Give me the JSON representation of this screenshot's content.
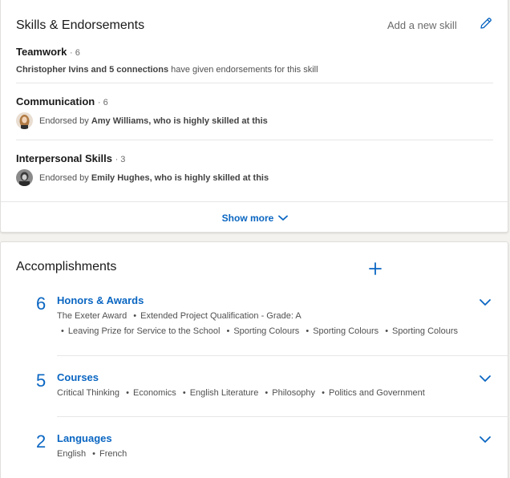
{
  "skills_section": {
    "title": "Skills & Endorsements",
    "add_skill_label": "Add a new skill",
    "show_more_label": "Show more",
    "skills": [
      {
        "name": "Teamwork",
        "count": "6",
        "endorsers_bold": "Christopher Ivins and 5 connections",
        "endorsers_text": " have given endorsements for this skill"
      },
      {
        "name": "Communication",
        "count": "6",
        "endorsed_by": "Endorsed by ",
        "endorser_bold": "Amy Williams, who is highly skilled at this"
      },
      {
        "name": "Interpersonal Skills",
        "count": "3",
        "endorsed_by": "Endorsed by ",
        "endorser_bold": "Emily Hughes, who is highly skilled at this"
      }
    ]
  },
  "accomplishments": {
    "title": "Accomplishments",
    "categories": [
      {
        "count": "6",
        "title": "Honors & Awards",
        "items": [
          "The Exeter Award",
          "Extended Project Qualification - Grade: A",
          "Leaving Prize for Service to the School",
          "Sporting Colours",
          "Sporting Colours",
          "Sporting Colours"
        ]
      },
      {
        "count": "5",
        "title": "Courses",
        "items": [
          "Critical Thinking",
          "Economics",
          "English Literature",
          "Philosophy",
          "Politics and Government"
        ]
      },
      {
        "count": "2",
        "title": "Languages",
        "items": [
          "English",
          "French"
        ]
      }
    ]
  },
  "colors": {
    "accent": "#0a66c2",
    "background": "#f3f2ef",
    "card": "#ffffff"
  },
  "icons": {
    "edit": "pencil-icon",
    "add": "plus-icon",
    "expand": "chevron-down-icon"
  }
}
